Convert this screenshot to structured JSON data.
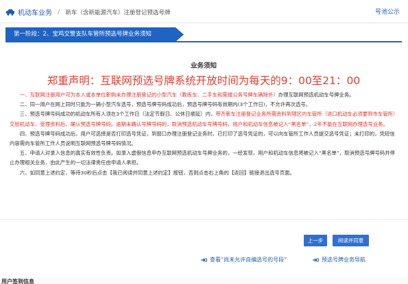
{
  "breadcrumb": {
    "root": "机动车业务",
    "current": "新车（含新能源汽车）注册登记预选号牌"
  },
  "header": {
    "notice_link": "号池公示"
  },
  "stage": {
    "label": "第一阶段：2、宝鸡交警支队车管所预选号牌业务须知"
  },
  "content": {
    "title": "业务须知",
    "declaration": "郑重声明：互联网预选号牌系统开放时间为每天的9：00至21：00",
    "p1_red": "一、互联网注册用户可为本人或本单位新购未办理注册登记的小型汽车（教练车、二手车和需报公务号牌车辆除外）",
    "p1_tail": "办理互联网预选机动车号牌业务。",
    "p2": "二、同一用户在网上同时只能为一辆小型汽车选号，预选号牌号码成功后，预选号牌号码有效期内(3个工作日)，不允许再次选号。",
    "p3_a": "三、预选号牌号码成功的机动车所有人须在3个工作日（法定节假日、公休日顺延）内，",
    "p3_red": "带齐新车注册登记业务所需资料到辖区内车管所（进口机动车必须要到市车管所）交验机动车、受理资料后，确认预选号牌号码。逾期未确认号牌号码的，取消预选机动车号牌号码，用户和机动车信息被记入“黑名单”，2年不能在互联网办理选号业务。",
    "p4": "四、预选号牌号码成功后，用户可选择是否打印选号凭证，到窗口办理注册登记业务时，已打印了选号凭证的，可以向车管所工作人员提交选号凭证；未打印的，凭短信内容需向车管所工作人员说明互联网预选号牌号码情况。",
    "p5": "五、申请人对录入信息的真实有效性负责。如录入虚假信息申办互联网预选机动车号牌业务的，一经发现，用户和机动车信息将被记入“黑名单”，取消预选号牌号码并停止办理相关业务，由此产生的一切法律责任由申请人承担。",
    "p6": "六、如同意上述约定，等待30秒后点击【我已阅读并同意上述约定】按钮，否则点击右上角的【返回】链接退出选号页面。"
  },
  "buttons": {
    "prev": "上一步",
    "agree": "阅读并同意"
  },
  "links": {
    "link1": "查看“尚未允许自编选号的号段”",
    "link2": "预选号牌业务导航"
  },
  "footer": {
    "text": "用户签到信息"
  },
  "colors": {
    "accent": "#1f63c3",
    "declaration": "#e03c31",
    "link": "#1f5ea8"
  },
  "icons": {
    "breadcrumb": "car-icon",
    "links": "pointing-hand-icon"
  }
}
